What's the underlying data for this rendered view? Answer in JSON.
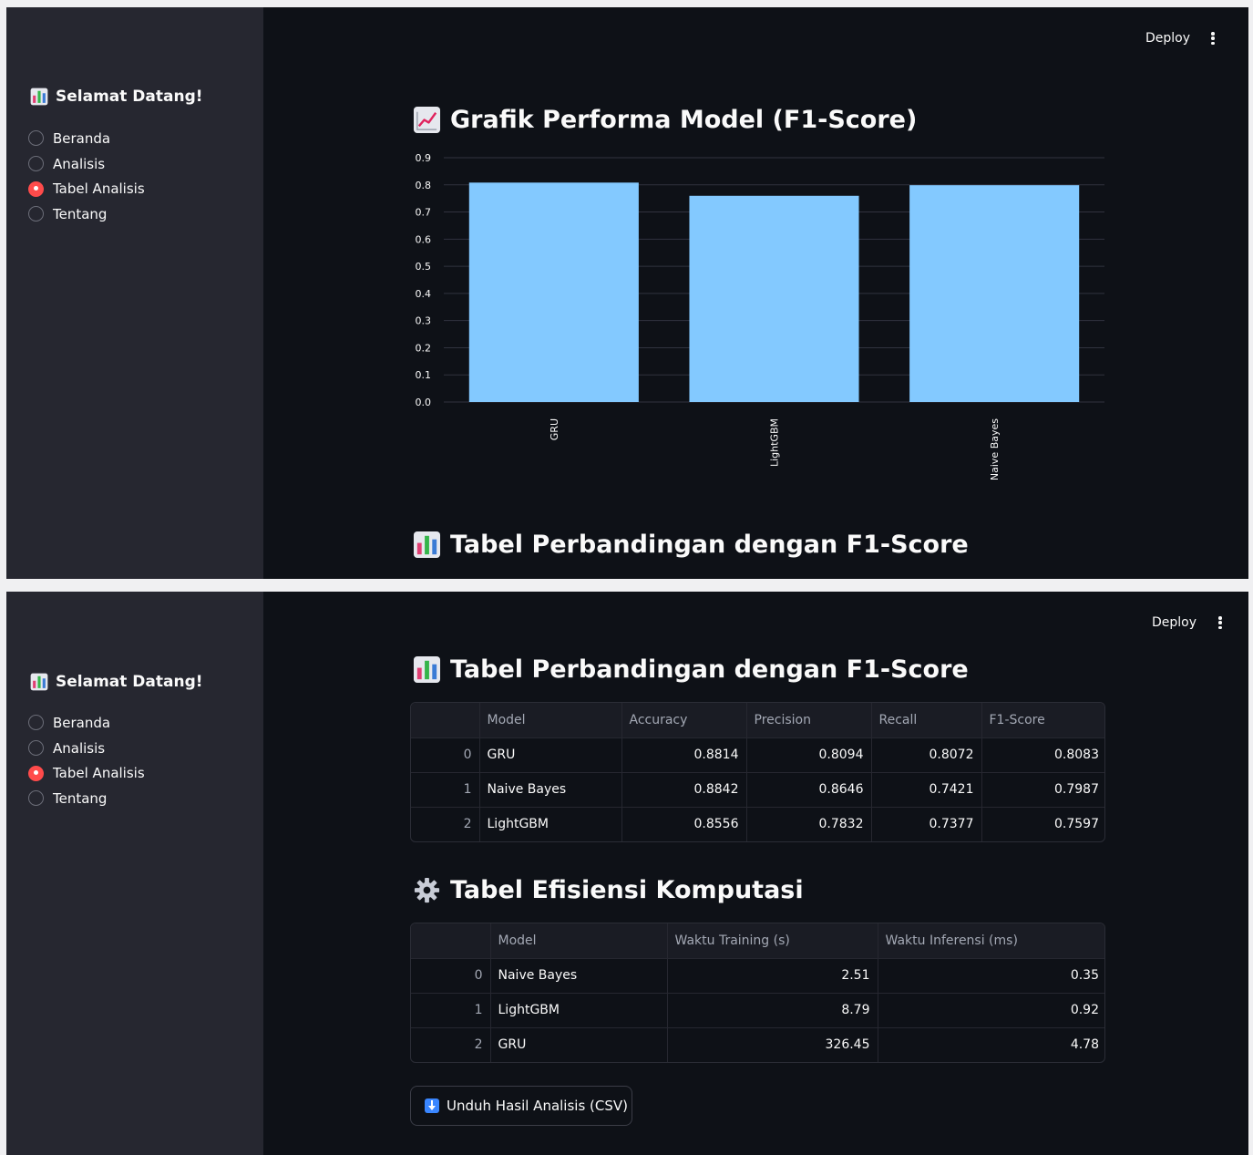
{
  "app": {
    "deploy_label": "Deploy"
  },
  "sidebar": {
    "title": "Selamat Datang!",
    "icon": "bar-chart-icon",
    "options": [
      "Beranda",
      "Analisis",
      "Tabel Analisis",
      "Tentang"
    ],
    "selected": "Tabel Analisis"
  },
  "chart_section": {
    "title": "Grafik Performa Model (F1-Score)",
    "icon": "chart-increasing-icon"
  },
  "chart_data": {
    "type": "bar",
    "title": "",
    "xlabel": "",
    "ylabel": "",
    "categories": [
      "GRU",
      "LightGBM",
      "Naive Bayes"
    ],
    "values": [
      0.8083,
      0.7597,
      0.7987
    ],
    "yticks": [
      "0.0",
      "0.1",
      "0.2",
      "0.3",
      "0.4",
      "0.5",
      "0.6",
      "0.7",
      "0.8",
      "0.9"
    ],
    "ylim": [
      0,
      0.9
    ],
    "grid": true,
    "bar_color": "#83c9ff"
  },
  "comparison_table": {
    "title": "Tabel Perbandingan dengan F1-Score",
    "icon": "bar-chart-icon",
    "columns": [
      "",
      "Model",
      "Accuracy",
      "Precision",
      "Recall",
      "F1-Score"
    ],
    "rows": [
      [
        "0",
        "GRU",
        "0.8814",
        "0.8094",
        "0.8072",
        "0.8083"
      ],
      [
        "1",
        "Naive Bayes",
        "0.8842",
        "0.8646",
        "0.7421",
        "0.7987"
      ],
      [
        "2",
        "LightGBM",
        "0.8556",
        "0.7832",
        "0.7377",
        "0.7597"
      ]
    ]
  },
  "efficiency_table": {
    "title": "Tabel Efisiensi Komputasi",
    "icon": "gear-icon",
    "columns": [
      "",
      "Model",
      "Waktu Training (s)",
      "Waktu Inferensi (ms)"
    ],
    "rows": [
      [
        "0",
        "Naive Bayes",
        "2.51",
        "0.35"
      ],
      [
        "1",
        "LightGBM",
        "8.79",
        "0.92"
      ],
      [
        "2",
        "GRU",
        "326.45",
        "4.78"
      ]
    ]
  },
  "download_button": {
    "label": "Unduh Hasil Analisis (CSV)",
    "icon": "download-arrow-icon"
  },
  "colors": {
    "background": "#0e1117",
    "sidebar": "#262730",
    "accent": "#ff4b4b",
    "bar": "#83c9ff"
  }
}
